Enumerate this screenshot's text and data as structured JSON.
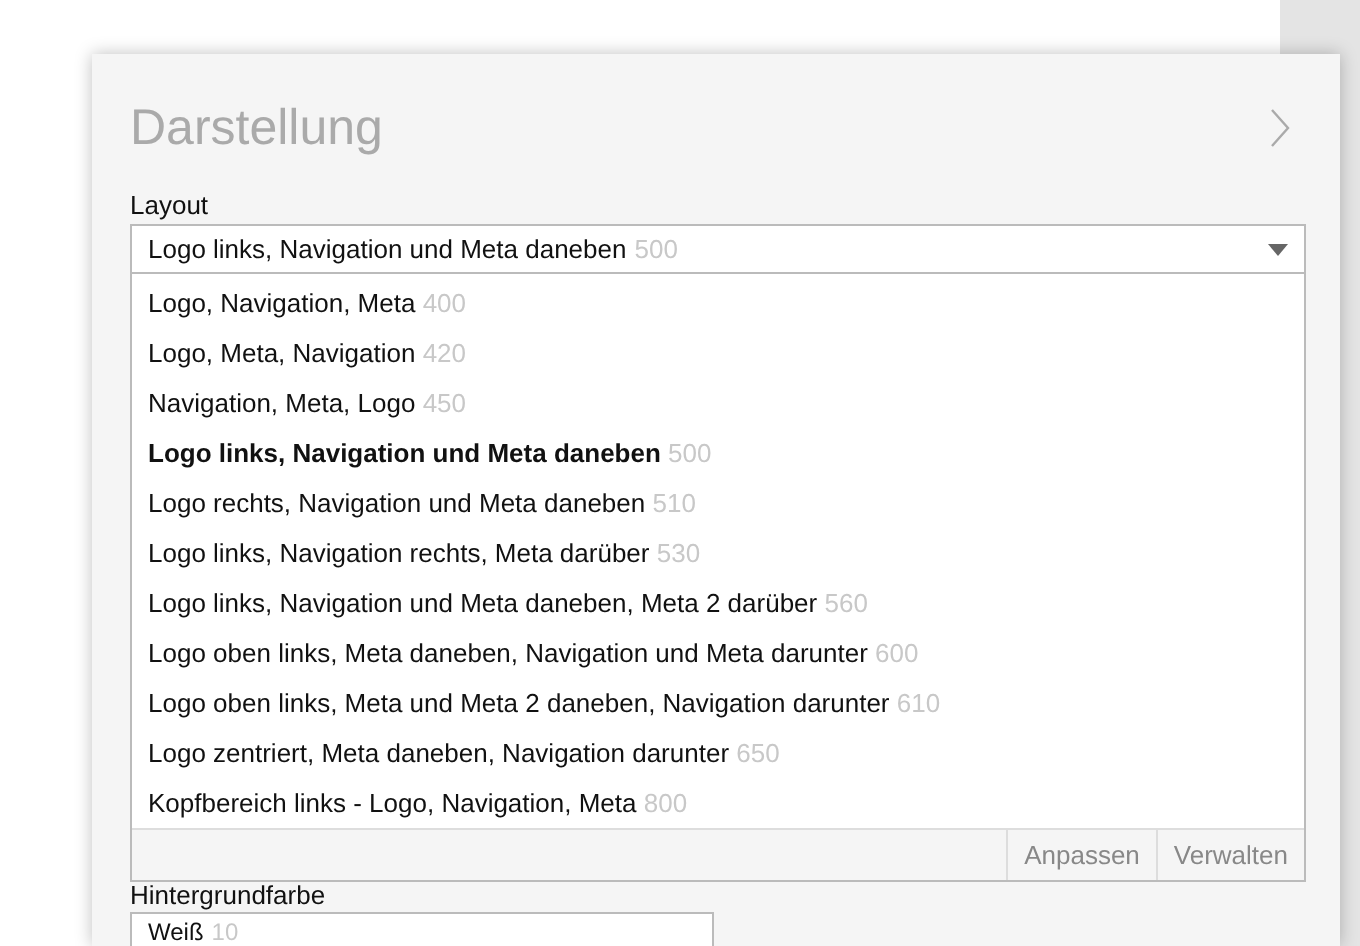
{
  "panel": {
    "title": "Darstellung"
  },
  "layout": {
    "label": "Layout",
    "value": "Logo links, Navigation und Meta daneben",
    "code": "500",
    "expanded": true,
    "options": [
      {
        "label": "Logo, Navigation, Meta",
        "code": "400",
        "selected": false
      },
      {
        "label": "Logo, Meta, Navigation",
        "code": "420",
        "selected": false
      },
      {
        "label": "Navigation, Meta, Logo",
        "code": "450",
        "selected": false
      },
      {
        "label": "Logo links, Navigation und Meta daneben",
        "code": "500",
        "selected": true
      },
      {
        "label": "Logo rechts, Navigation und Meta daneben",
        "code": "510",
        "selected": false
      },
      {
        "label": "Logo links, Navigation rechts, Meta darüber",
        "code": "530",
        "selected": false
      },
      {
        "label": "Logo links, Navigation und Meta daneben, Meta 2 darüber",
        "code": "560",
        "selected": false
      },
      {
        "label": "Logo oben links, Meta daneben, Navigation und Meta darunter",
        "code": "600",
        "selected": false
      },
      {
        "label": "Logo oben links, Meta und Meta 2 daneben, Navigation darunter",
        "code": "610",
        "selected": false
      },
      {
        "label": "Logo zentriert, Meta daneben, Navigation darunter",
        "code": "650",
        "selected": false
      },
      {
        "label": "Kopfbereich links - Logo, Navigation, Meta",
        "code": "800",
        "selected": false
      }
    ],
    "footer_buttons": [
      "Anpassen",
      "Verwalten"
    ]
  },
  "background": {
    "label": "Hintergrundfarbe",
    "value": "Weiß",
    "code": "10"
  }
}
